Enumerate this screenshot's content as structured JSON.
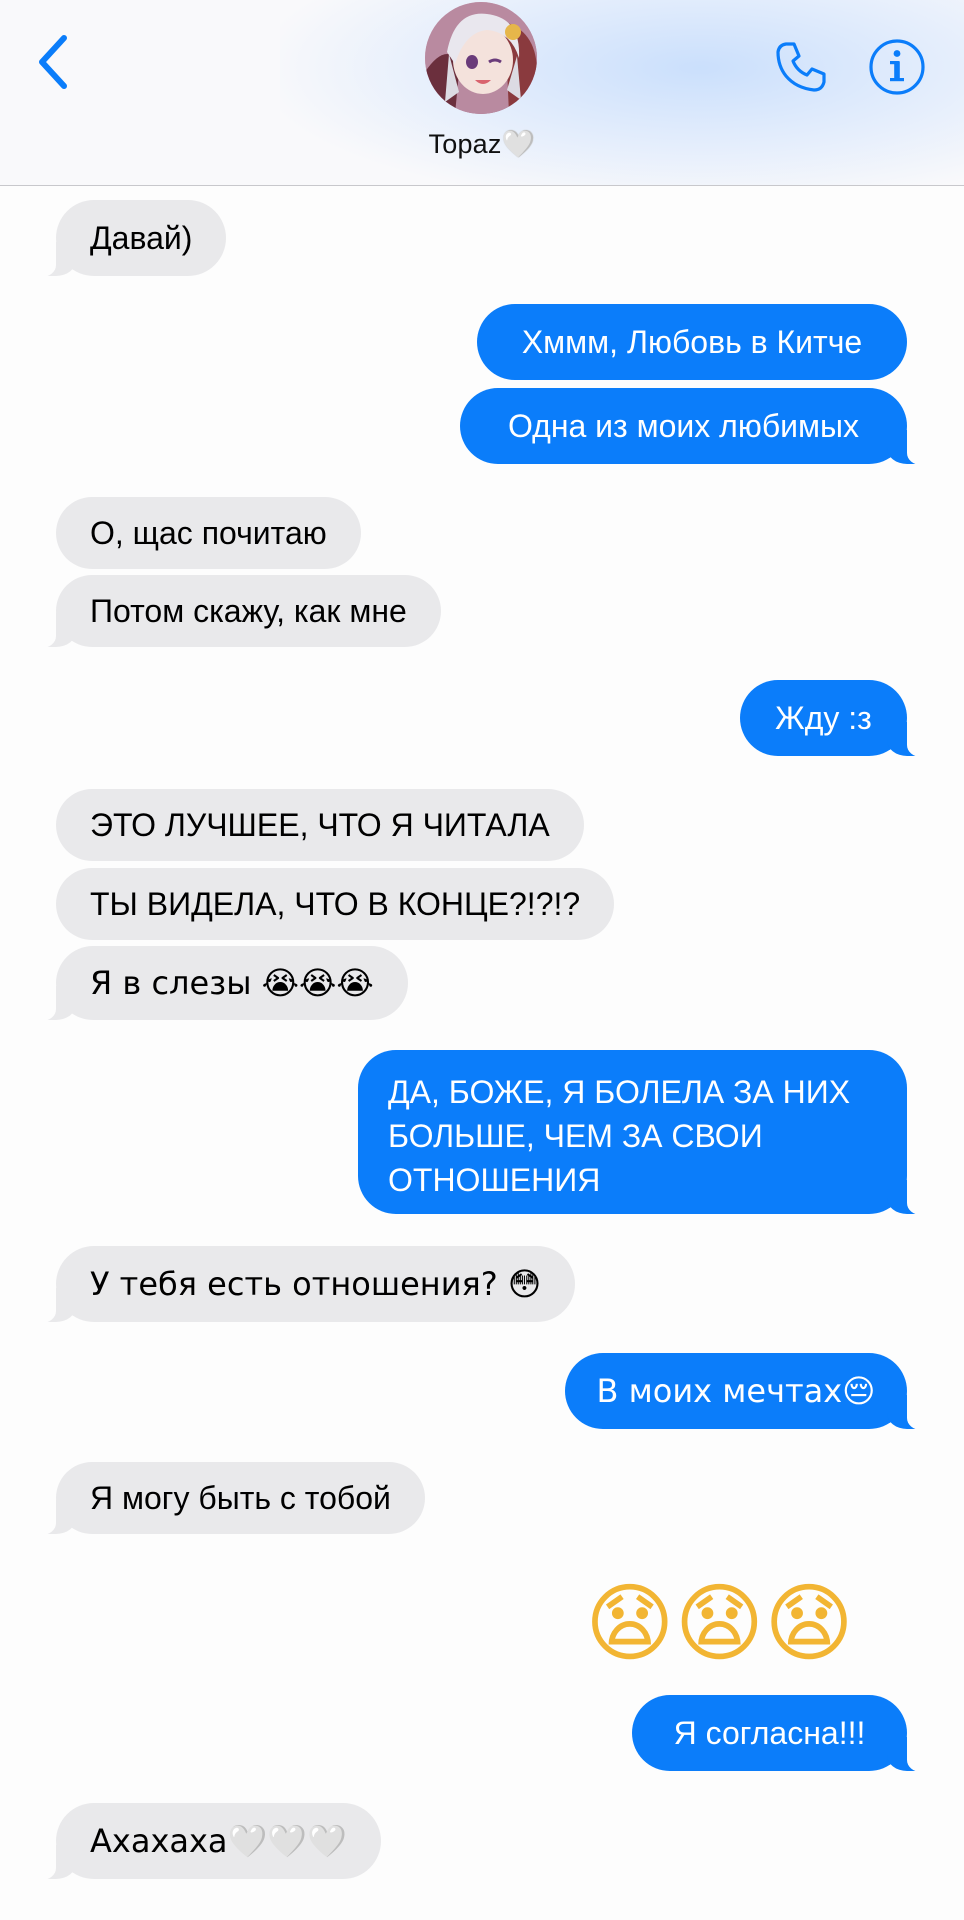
{
  "header": {
    "contact_name": "Topaz",
    "contact_heart": "🤍",
    "back_icon": "chevron-left-icon",
    "call_icon": "phone-icon",
    "info_icon": "info-icon",
    "accent_color": "#0b7dfa"
  },
  "messages": [
    {
      "from": "them",
      "text": "Давай)"
    },
    {
      "from": "me",
      "text": "Хммм, Любовь в Китче"
    },
    {
      "from": "me",
      "text": "Одна из моих любимых"
    },
    {
      "from": "them",
      "text": "О, щас почитаю"
    },
    {
      "from": "them",
      "text": "Потом скажу, как мне"
    },
    {
      "from": "me",
      "text": "Жду :з"
    },
    {
      "from": "them",
      "text": "ЭТО ЛУЧШЕЕ, ЧТО Я ЧИТАЛА"
    },
    {
      "from": "them",
      "text": "ТЫ ВИДЕЛА, ЧТО В КОНЦЕ?!?!?"
    },
    {
      "from": "them",
      "text": "Я в слезы 😭😭😭"
    },
    {
      "from": "me",
      "text": "ДА, БОЖЕ, Я БОЛЕЛА ЗА НИХ БОЛЬШЕ, ЧЕМ ЗА СВОИ ОТНОШЕНИЯ"
    },
    {
      "from": "them",
      "text": "У тебя есть отношения? 😳"
    },
    {
      "from": "me",
      "text": "В моих мечтах😔"
    },
    {
      "from": "them",
      "text": "Я могу быть с тобой"
    },
    {
      "from": "me",
      "text": "😧😧😧"
    },
    {
      "from": "me",
      "text": "Я согласна!!!"
    },
    {
      "from": "them",
      "text": "Ахахаха🤍🤍🤍"
    }
  ]
}
